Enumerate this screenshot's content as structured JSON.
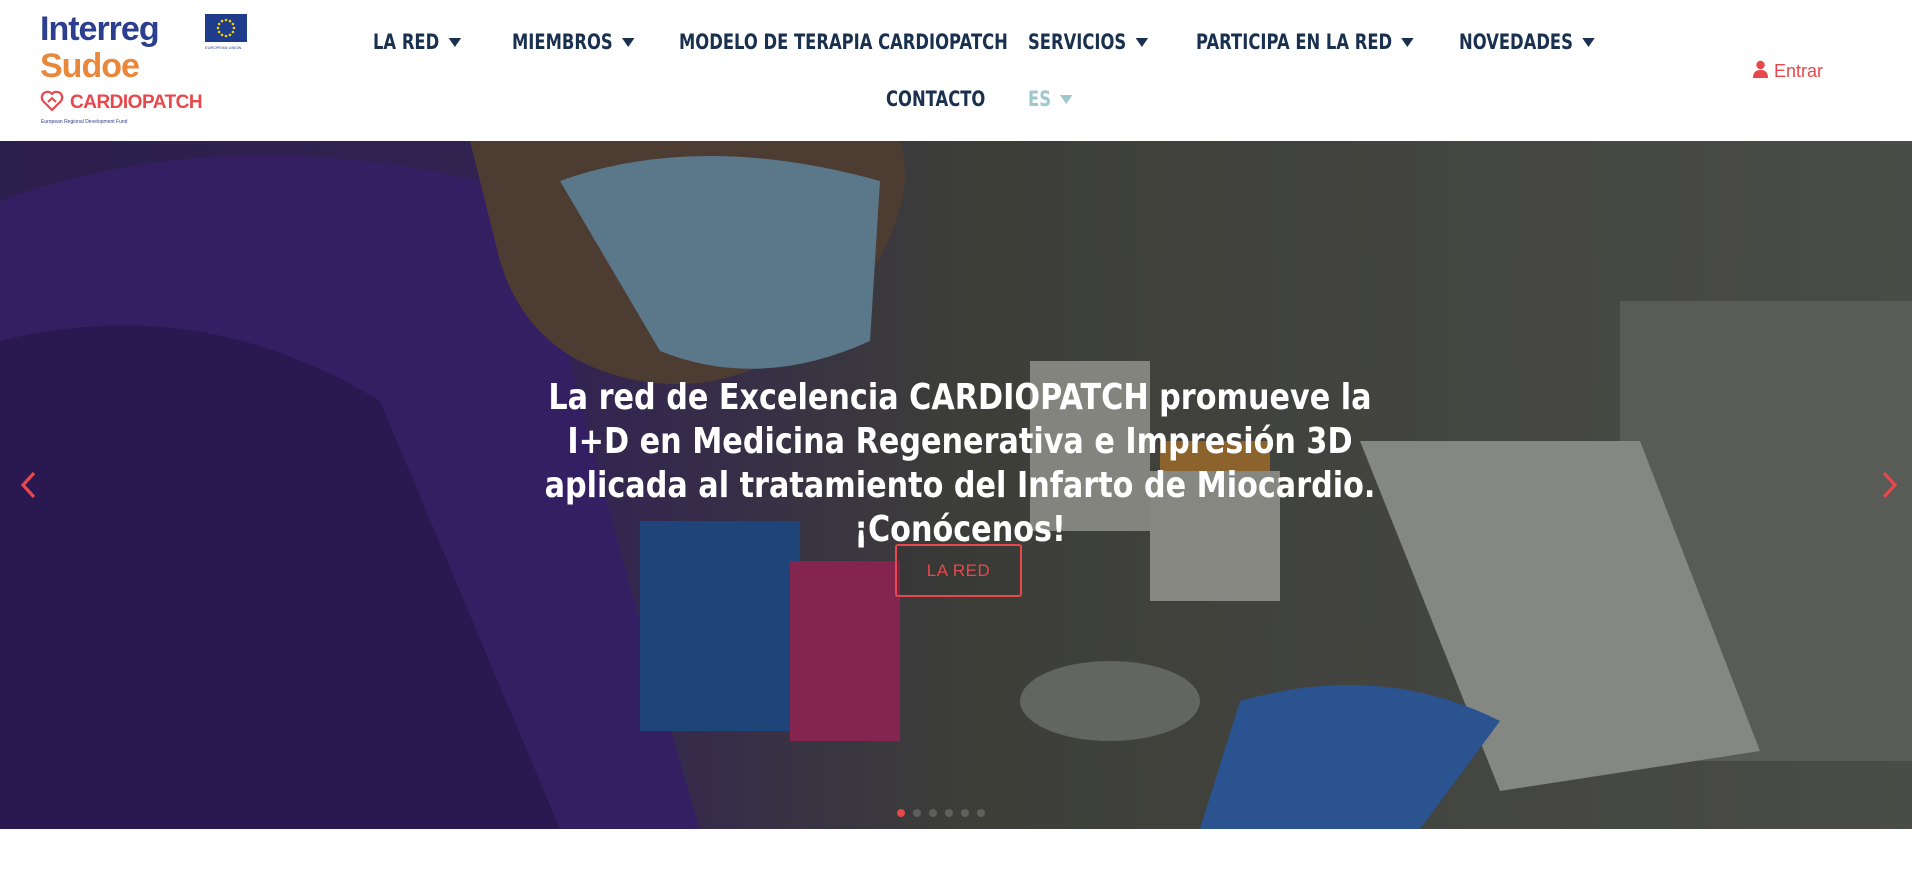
{
  "brand": {
    "interreg": "Interreg",
    "sudoe": "Sudoe",
    "eu_label": "EUROPEAN UNION",
    "name": "CARDIOPATCH",
    "fund": "European Regional Development Fund"
  },
  "nav": {
    "items": [
      {
        "label": "LA RED",
        "has_dropdown": true
      },
      {
        "label": "MIEMBROS",
        "has_dropdown": true
      },
      {
        "label": "MODELO DE TERAPIA CARDIOPATCH",
        "has_dropdown": false
      },
      {
        "label": "SERVICIOS",
        "has_dropdown": true
      },
      {
        "label": "PARTICIPA EN LA RED",
        "has_dropdown": true
      },
      {
        "label": "NOVEDADES",
        "has_dropdown": true
      },
      {
        "label": "CONTACTO",
        "has_dropdown": false
      }
    ],
    "language": "ES",
    "login_label": "Entrar"
  },
  "hero": {
    "title": "La red de Excelencia CARDIOPATCH promueve la I+D en Medicina Regenerativa e Impresión 3D aplicada al tratamiento del Infarto de Miocardio. ¡Conócenos!",
    "button_label": "LA RED",
    "active_slide_index": 0
  },
  "colors": {
    "accent": "#e8484c",
    "nav_text": "#19304f",
    "language_link": "#9ec8cd",
    "interreg_blue": "#2c3f8f",
    "sudoe_orange": "#e9883b"
  },
  "icons": {
    "login": "user-icon",
    "prev": "chevron-left-icon",
    "next": "chevron-right-icon",
    "logo_mark": "heart-icon",
    "dropdown": "caret-down-icon"
  }
}
